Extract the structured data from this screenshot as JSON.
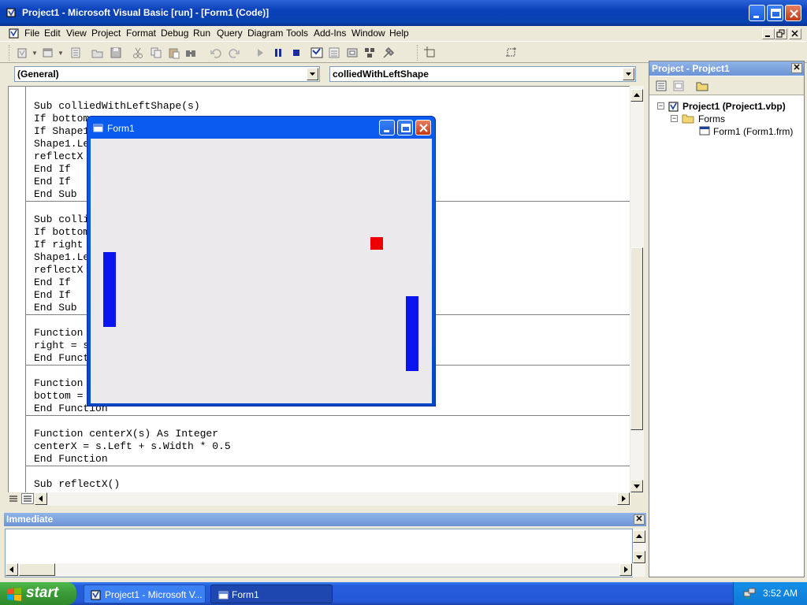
{
  "titlebar": {
    "title": "Project1 - Microsoft Visual Basic [run] - [Form1 (Code)]"
  },
  "menubar": {
    "items": [
      "File",
      "Edit",
      "View",
      "Project",
      "Format",
      "Debug",
      "Run",
      "Query",
      "Diagram",
      "Tools",
      "Add-Ins",
      "Window",
      "Help"
    ]
  },
  "toolbar": {
    "icons": [
      "add-project-icon",
      "add-form-icon",
      "menu-editor-icon",
      "open-icon",
      "save-icon",
      "cut-icon",
      "copy-icon",
      "paste-icon",
      "find-icon",
      "undo-icon",
      "redo-icon",
      "start-icon",
      "break-icon",
      "end-icon",
      "project-explorer-icon",
      "properties-icon",
      "form-layout-icon",
      "object-browser-icon",
      "toolbox-icon",
      "position-icon",
      "size-icon"
    ]
  },
  "codewindow": {
    "object_combo": "(General)",
    "procedure_combo": "colliedWithLeftShape",
    "lines": [
      {
        "text": "Sub colliedWithLeftShape(s)"
      },
      {
        "text": "If bottom"
      },
      {
        "text": "If Shape1"
      },
      {
        "text": "Shape1.Le"
      },
      {
        "text": "reflectX"
      },
      {
        "text": "End If"
      },
      {
        "text": "End If"
      },
      {
        "text": "End Sub"
      },
      {
        "text": "Sub colli"
      },
      {
        "text": "If bottom"
      },
      {
        "text": "If right"
      },
      {
        "text": "Shape1.Le"
      },
      {
        "text": "reflectX"
      },
      {
        "text": "End If"
      },
      {
        "text": "End If"
      },
      {
        "text": "End Sub"
      },
      {
        "text": "Function"
      },
      {
        "text": "right = s"
      },
      {
        "text": "End Funct"
      },
      {
        "text": "Function"
      },
      {
        "text": "bottom ="
      },
      {
        "text": "End Function"
      },
      {
        "text": "Function centerX(s) As Integer"
      },
      {
        "text": "centerX = s.Left + s.Width * 0.5"
      },
      {
        "text": "End Function"
      },
      {
        "text": "Sub reflectX()"
      }
    ]
  },
  "form1": {
    "title": "Form1",
    "paddle_color": "#0a14f0",
    "ball_color": "#ee0000",
    "client_color": "#ece9ed"
  },
  "immediate": {
    "title": "Immediate"
  },
  "project": {
    "title": "Project - Project1",
    "tree": {
      "root": "Project1 (Project1.vbp)",
      "folder": "Forms",
      "item": "Form1 (Form1.frm)"
    }
  },
  "taskbar": {
    "start_label": "start",
    "tasks": [
      "Project1 - Microsoft V...",
      "Form1"
    ],
    "clock": "3:52 AM"
  }
}
